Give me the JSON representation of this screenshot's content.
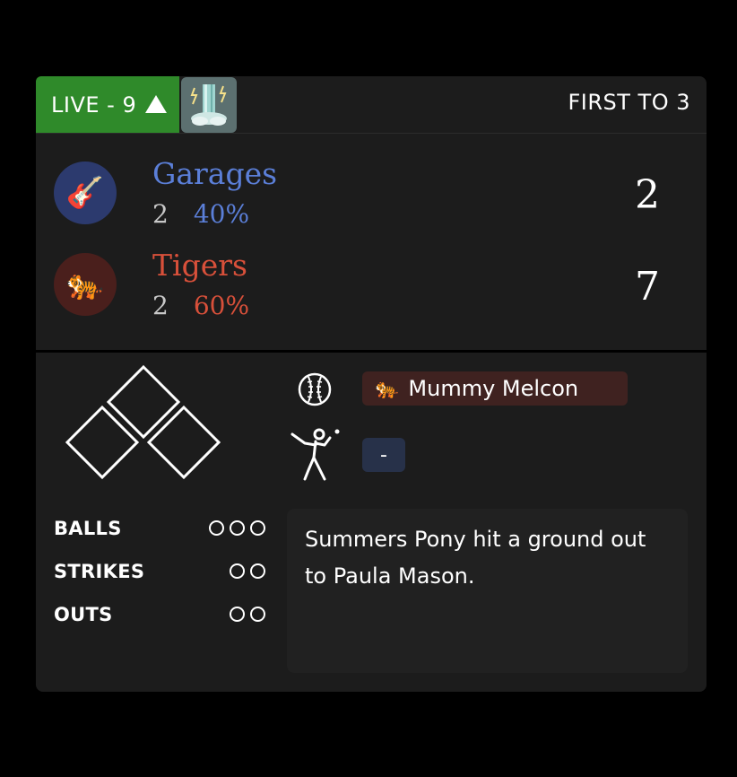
{
  "header": {
    "live_label": "LIVE - 9",
    "inning_half": "top",
    "weather_icon": "thunderstorm-waterfall-icon",
    "first_to": "FIRST TO 3"
  },
  "teams": [
    {
      "name": "Garages",
      "emoji": "🎸",
      "record": "2",
      "win_pct": "40%",
      "score": "2",
      "color": "#5b7fd8",
      "logo_bg": "#2c3a6e"
    },
    {
      "name": "Tigers",
      "emoji": "🐅",
      "record": "2",
      "win_pct": "60%",
      "score": "7",
      "color": "#d8503a",
      "logo_bg": "#4a1f1c"
    }
  ],
  "bases": {
    "first": false,
    "second": false,
    "third": false
  },
  "pitcher": {
    "emoji": "🐅",
    "name": "Mummy Melcon",
    "icon": "baseball-icon"
  },
  "batter": {
    "name": "-",
    "icon": "batter-icon"
  },
  "count": {
    "balls_label": "BALLS",
    "balls": 0,
    "balls_max": 3,
    "strikes_label": "STRIKES",
    "strikes": 0,
    "strikes_max": 2,
    "outs_label": "OUTS",
    "outs": 0,
    "outs_max": 2
  },
  "last_update": "Summers Pony hit a ground out to Paula Mason."
}
